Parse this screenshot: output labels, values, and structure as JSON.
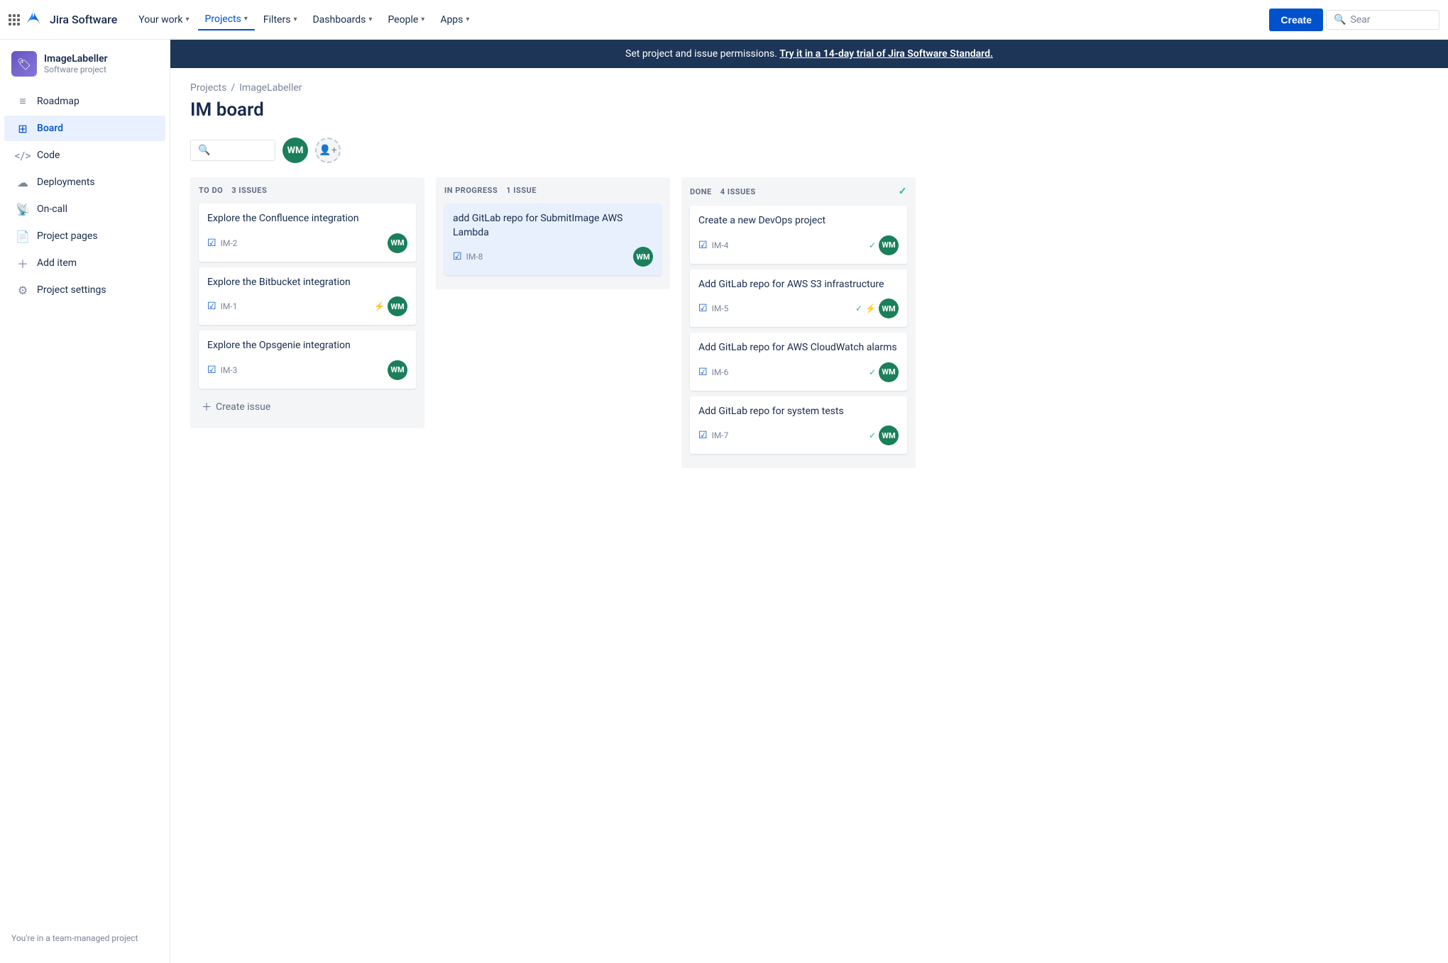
{
  "topnav": {
    "logo_text": "Jira Software",
    "nav_items": [
      {
        "label": "Your work",
        "has_chevron": true,
        "active": false
      },
      {
        "label": "Projects",
        "has_chevron": true,
        "active": true
      },
      {
        "label": "Filters",
        "has_chevron": true,
        "active": false
      },
      {
        "label": "Dashboards",
        "has_chevron": true,
        "active": false
      },
      {
        "label": "People",
        "has_chevron": true,
        "active": false
      },
      {
        "label": "Apps",
        "has_chevron": true,
        "active": false
      }
    ],
    "create_label": "Create",
    "search_placeholder": "Sear"
  },
  "sidebar": {
    "project_name": "ImageLabeller",
    "project_type": "Software project",
    "project_avatar_text": "🏷",
    "items": [
      {
        "label": "Roadmap",
        "icon": "roadmap",
        "active": false
      },
      {
        "label": "Board",
        "icon": "board",
        "active": true
      },
      {
        "label": "Code",
        "icon": "code",
        "active": false
      },
      {
        "label": "Deployments",
        "icon": "deployments",
        "active": false
      },
      {
        "label": "On-call",
        "icon": "oncall",
        "active": false
      },
      {
        "label": "Project pages",
        "icon": "pages",
        "active": false
      },
      {
        "label": "Add item",
        "icon": "add",
        "active": false
      },
      {
        "label": "Project settings",
        "icon": "settings",
        "active": false
      }
    ],
    "footer_text": "You're in a team-managed project"
  },
  "banner": {
    "text": "Set project and issue permissions.",
    "link_text": "Try it in a 14-day trial of Jira Software Standard."
  },
  "breadcrumb": {
    "projects": "Projects",
    "separator": "/",
    "current": "ImageLabeller"
  },
  "page_title": "IM board",
  "avatar_initials": "WM",
  "columns": [
    {
      "title": "TO DO",
      "issue_count": "3 ISSUES",
      "show_check": false,
      "cards": [
        {
          "title": "Explore the Confluence integration",
          "id": "IM-2",
          "avatar": "WM",
          "icons": [],
          "highlighted": false
        },
        {
          "title": "Explore the Bitbucket integration",
          "id": "IM-1",
          "avatar": "WM",
          "icons": [
            "link"
          ],
          "highlighted": false
        },
        {
          "title": "Explore the Opsgenie integration",
          "id": "IM-3",
          "avatar": "WM",
          "icons": [],
          "highlighted": false
        }
      ],
      "create_label": "Create issue"
    },
    {
      "title": "IN PROGRESS",
      "issue_count": "1 ISSUE",
      "show_check": false,
      "cards": [
        {
          "title": "add GitLab repo for SubmitImage AWS Lambda",
          "id": "IM-8",
          "avatar": "WM",
          "icons": [],
          "highlighted": true
        }
      ],
      "create_label": null
    },
    {
      "title": "DONE",
      "issue_count": "4 ISSUES",
      "show_check": true,
      "cards": [
        {
          "title": "Create a new DevOps project",
          "id": "IM-4",
          "avatar": "WM",
          "icons": [
            "check"
          ],
          "highlighted": false
        },
        {
          "title": "Add GitLab repo for AWS S3 infrastructure",
          "id": "IM-5",
          "avatar": "WM",
          "icons": [
            "check",
            "link"
          ],
          "highlighted": false
        },
        {
          "title": "Add GitLab repo for AWS CloudWatch alarms",
          "id": "IM-6",
          "avatar": "WM",
          "icons": [
            "check"
          ],
          "highlighted": false
        },
        {
          "title": "Add GitLab repo for system tests",
          "id": "IM-7",
          "avatar": "WM",
          "icons": [
            "check"
          ],
          "highlighted": false
        }
      ],
      "create_label": null
    }
  ]
}
